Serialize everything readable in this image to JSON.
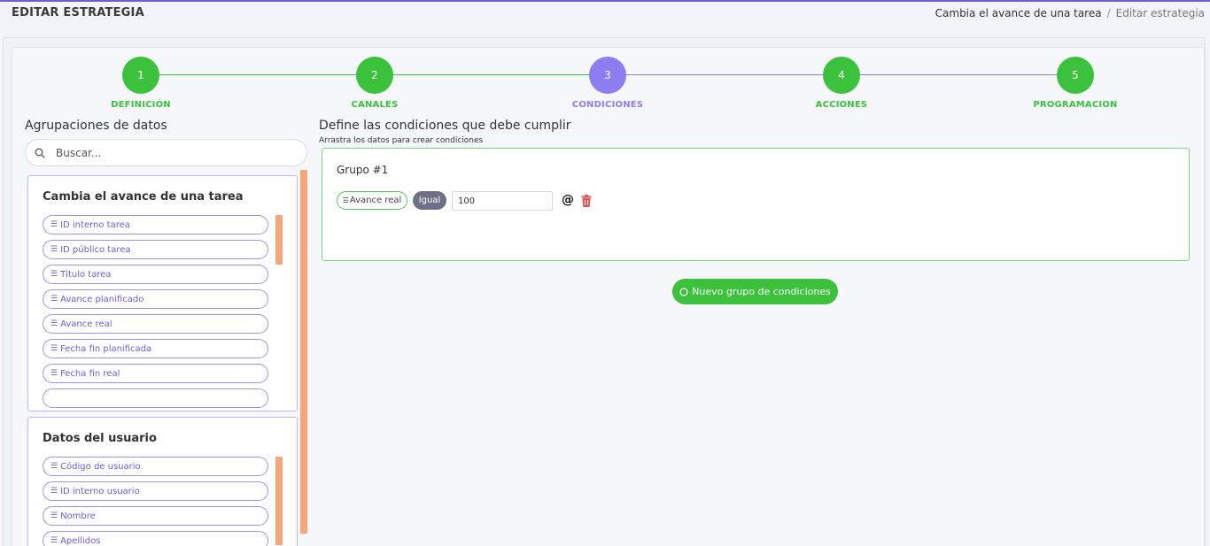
{
  "header": {
    "title": "EDITAR ESTRATEGIA",
    "breadcrumb": [
      "Cambia el avance de una tarea",
      "Editar estrategia"
    ]
  },
  "stepper": {
    "steps": [
      {
        "number": "1",
        "label": "DEFINICIÓN",
        "state": "done"
      },
      {
        "number": "2",
        "label": "CANALES",
        "state": "done"
      },
      {
        "number": "3",
        "label": "CONDICIONES",
        "state": "active"
      },
      {
        "number": "4",
        "label": "ACCIONES",
        "state": "done"
      },
      {
        "number": "5",
        "label": "PROGRAMACION",
        "state": "done"
      }
    ],
    "colors": {
      "done": "#3bc13b",
      "active": "#8c7ef0"
    }
  },
  "left": {
    "title": "Agrupaciones de datos",
    "search_placeholder": "Buscar...",
    "groups": [
      {
        "title": "Cambia el avance de una tarea",
        "items": [
          "ID interno tarea",
          "ID público tarea",
          "Título tarea",
          "Avance planificado",
          "Avance real",
          "Fecha fin planificada",
          "Fecha fin real"
        ]
      },
      {
        "title": "Datos del usuario",
        "items": [
          "Código de usuario",
          "ID interno usuario",
          "Nombre",
          "Apellidos"
        ]
      }
    ]
  },
  "conditions": {
    "title": "Define las condiciones que debe cumplir",
    "subtitle": "Arrastra los datos para crear condiciones",
    "group": {
      "title": "Grupo #1",
      "field": "Avance real",
      "operator": "Igual",
      "value": "100",
      "at_symbol": "@"
    },
    "new_group_label": "Nuevo grupo de condiciones"
  }
}
